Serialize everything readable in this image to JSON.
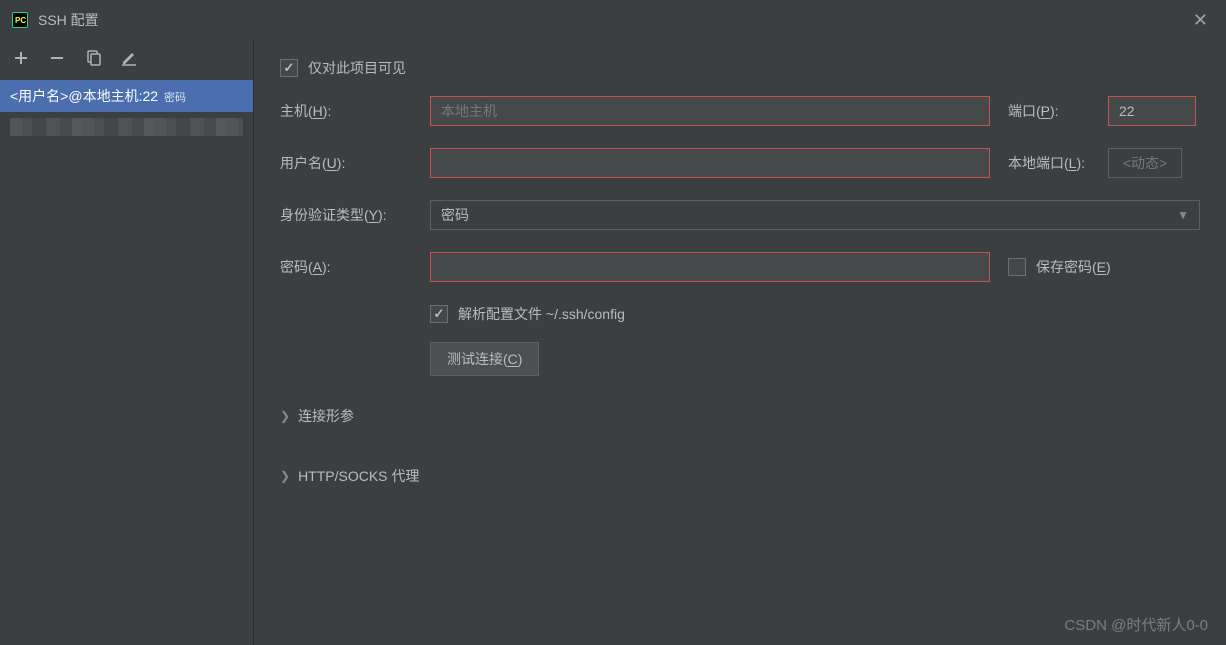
{
  "titlebar": {
    "title": "SSH 配置"
  },
  "sidebar": {
    "items": [
      {
        "label": "<用户名>@本地主机:22",
        "suffix": "密码",
        "selected": true
      },
      {
        "label": "",
        "suffix": "",
        "mosaic": true
      }
    ]
  },
  "form": {
    "visible_only_label": "仅对此项目可见",
    "host_label_pre": "主机(",
    "host_mn": "H",
    "host_label_post": "):",
    "host_placeholder": "本地主机",
    "host_value": "",
    "port_label_pre": "端口(",
    "port_mn": "P",
    "port_label_post": "):",
    "port_value": "22",
    "user_label_pre": "用户名(",
    "user_mn": "U",
    "user_label_post": "):",
    "user_value": "",
    "local_port_label_pre": "本地端口(",
    "local_port_mn": "L",
    "local_port_label_post": "):",
    "local_port_placeholder": "<动态>",
    "auth_label_pre": "身份验证类型(",
    "auth_mn": "Y",
    "auth_label_post": "):",
    "auth_value": "密码",
    "pass_label_pre": "密码(",
    "pass_mn": "A",
    "pass_label_post": "):",
    "pass_value": "",
    "save_pass_label_pre": "保存密码(",
    "save_pass_mn": "E",
    "save_pass_label_post": ")",
    "parse_cfg_label": "解析配置文件 ~/.ssh/config",
    "test_btn_pre": "测试连接(",
    "test_btn_mn": "C",
    "test_btn_post": ")",
    "expander1": "连接形参",
    "expander2": "HTTP/SOCKS 代理"
  },
  "watermark": "CSDN @时代新人0-0"
}
